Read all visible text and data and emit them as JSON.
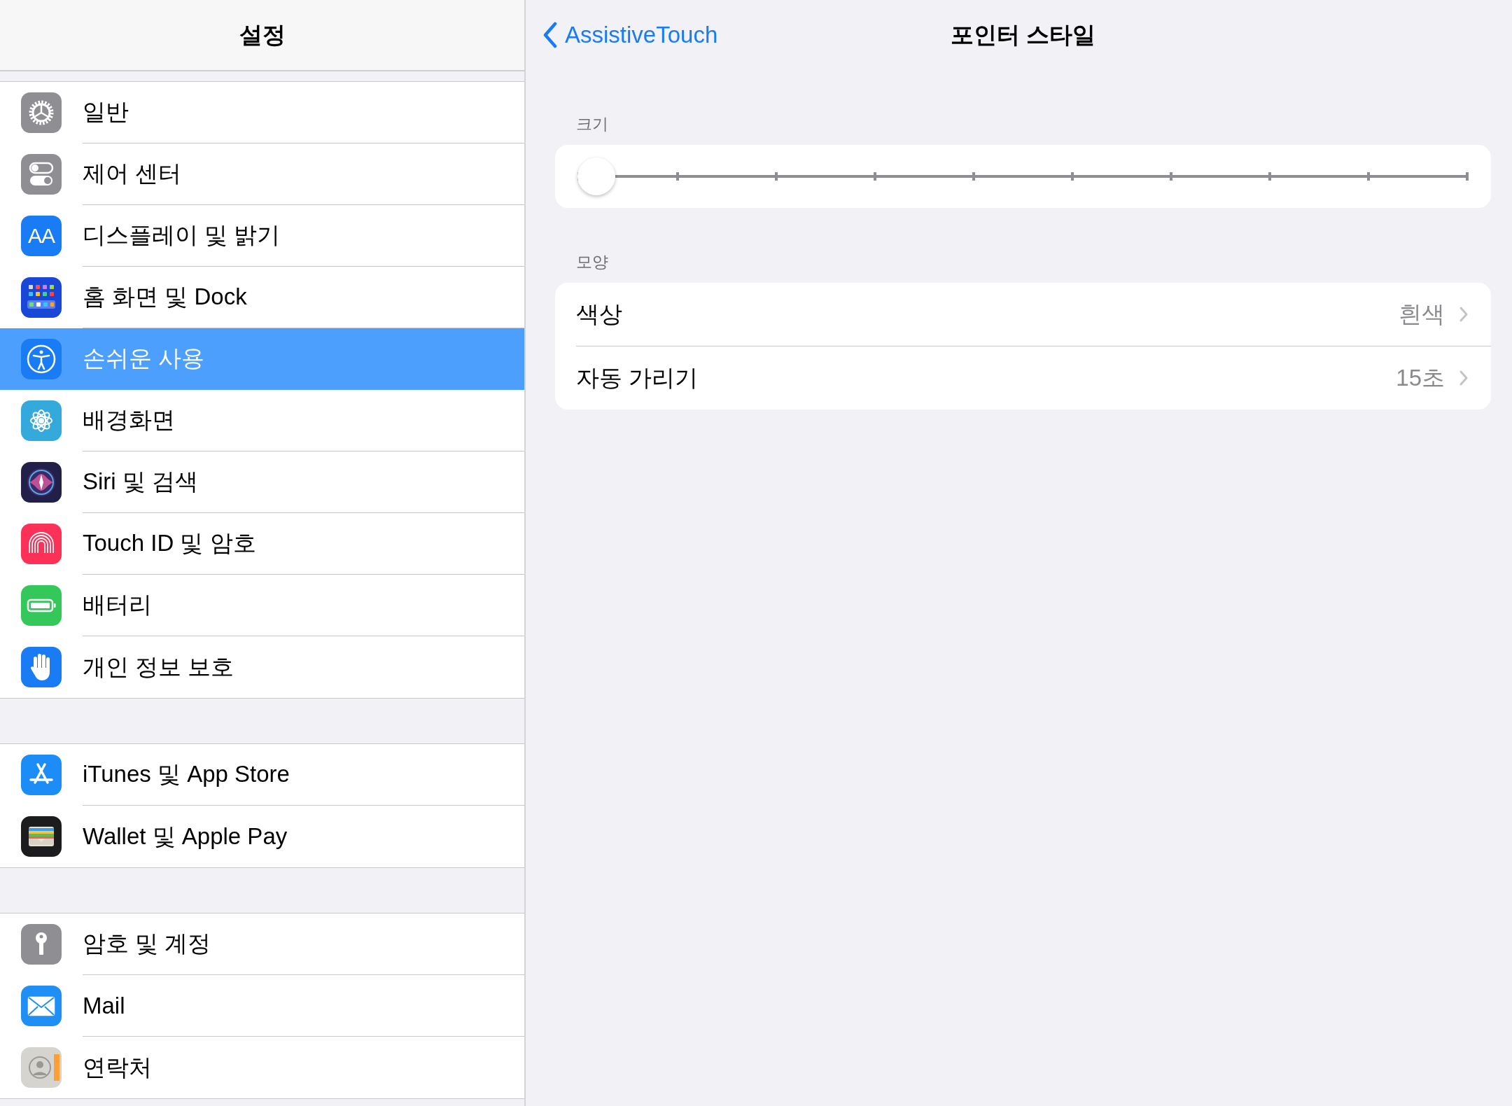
{
  "sidebar": {
    "title": "설정",
    "groups": [
      {
        "items": [
          {
            "kind": "gear",
            "label": "일반",
            "selected": false
          },
          {
            "kind": "toggles",
            "label": "제어 센터",
            "selected": false
          },
          {
            "kind": "text",
            "icon_text": "AA",
            "label": "디스플레이 및 밝기",
            "selected": false
          },
          {
            "kind": "grid",
            "label": "홈 화면 및 Dock",
            "selected": false
          },
          {
            "kind": "accessibility",
            "label": "손쉬운 사용",
            "selected": true
          },
          {
            "kind": "flower",
            "label": "배경화면",
            "selected": false
          },
          {
            "kind": "siri",
            "label": "Siri 및 검색",
            "selected": false
          },
          {
            "kind": "fingerprint",
            "label": "Touch ID 및 암호",
            "selected": false
          },
          {
            "kind": "battery",
            "label": "배터리",
            "selected": false
          },
          {
            "kind": "hand",
            "label": "개인 정보 보호",
            "selected": false
          }
        ]
      },
      {
        "items": [
          {
            "kind": "appstore",
            "label": "iTunes 및 App Store",
            "selected": false
          },
          {
            "kind": "wallet",
            "label": "Wallet 및 Apple Pay",
            "selected": false
          }
        ]
      },
      {
        "items": [
          {
            "kind": "key",
            "label": "암호 및 계정",
            "selected": false
          },
          {
            "kind": "mail",
            "label": "Mail",
            "selected": false
          },
          {
            "kind": "contacts",
            "label": "연락처",
            "selected": false
          }
        ]
      }
    ]
  },
  "detail": {
    "back": "AssistiveTouch",
    "title": "포인터 스타일",
    "size_section": {
      "header": "크기",
      "slider": {
        "level": 0
      }
    },
    "appearance_section": {
      "header": "모양",
      "rows": [
        {
          "label": "색상",
          "value": "흰색"
        },
        {
          "label": "자동 가리기",
          "value": "15초"
        }
      ]
    }
  }
}
